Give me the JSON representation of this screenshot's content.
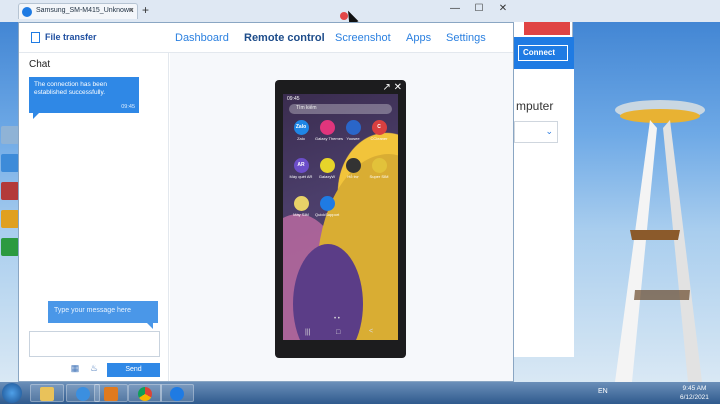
{
  "browser": {
    "tab_title": "Samsung_SM-M415_Unknown",
    "tab_close": "×",
    "new_tab": "+"
  },
  "window_controls": {
    "minimize": "—",
    "maximize": "☐",
    "close": "✕"
  },
  "app": {
    "file_transfer_label": "File transfer",
    "nav": [
      {
        "label": "Dashboard",
        "active": false
      },
      {
        "label": "Remote control",
        "active": true
      },
      {
        "label": "Screenshot",
        "active": false
      },
      {
        "label": "Apps",
        "active": false
      },
      {
        "label": "Settings",
        "active": false
      }
    ]
  },
  "chat": {
    "title": "Chat",
    "message": "The connection has been established successfully.",
    "message_time": "09:45",
    "input_hint": "Type your message here",
    "send_label": "Send"
  },
  "phone": {
    "status_time": "09:45",
    "search_placeholder": "Tìm kiếm",
    "apps": [
      {
        "name": "Zalo",
        "icon_text": "Zalo",
        "color": "#1f86e5"
      },
      {
        "name": "Galaxy Themes",
        "icon_text": "",
        "color": "#e0357c"
      },
      {
        "name": "Yoosee",
        "icon_text": "",
        "color": "#2a66c9"
      },
      {
        "name": "CCleaner",
        "icon_text": "C",
        "color": "#d94040"
      },
      {
        "name": "Máy quét AR",
        "icon_text": "AR",
        "color": "#6c4ec9"
      },
      {
        "name": "GalaxyW",
        "icon_text": "",
        "color": "#e6d42a"
      },
      {
        "name": "Hỗ trợ",
        "icon_text": "",
        "color": "#333333"
      },
      {
        "name": "Super SIM",
        "icon_text": "",
        "color": "#e2c23a"
      },
      {
        "name": "Máy SIM",
        "icon_text": "",
        "color": "#e8d268"
      },
      {
        "name": "QuickSupport",
        "icon_text": "",
        "color": "#1f7be3"
      }
    ],
    "page_dots": "• •"
  },
  "bg_window": {
    "connect_label": "Connect",
    "heading_fragment": "mputer"
  },
  "taskbar": {
    "language": "EN",
    "time": "9:45 AM",
    "date": "6/12/2021"
  }
}
